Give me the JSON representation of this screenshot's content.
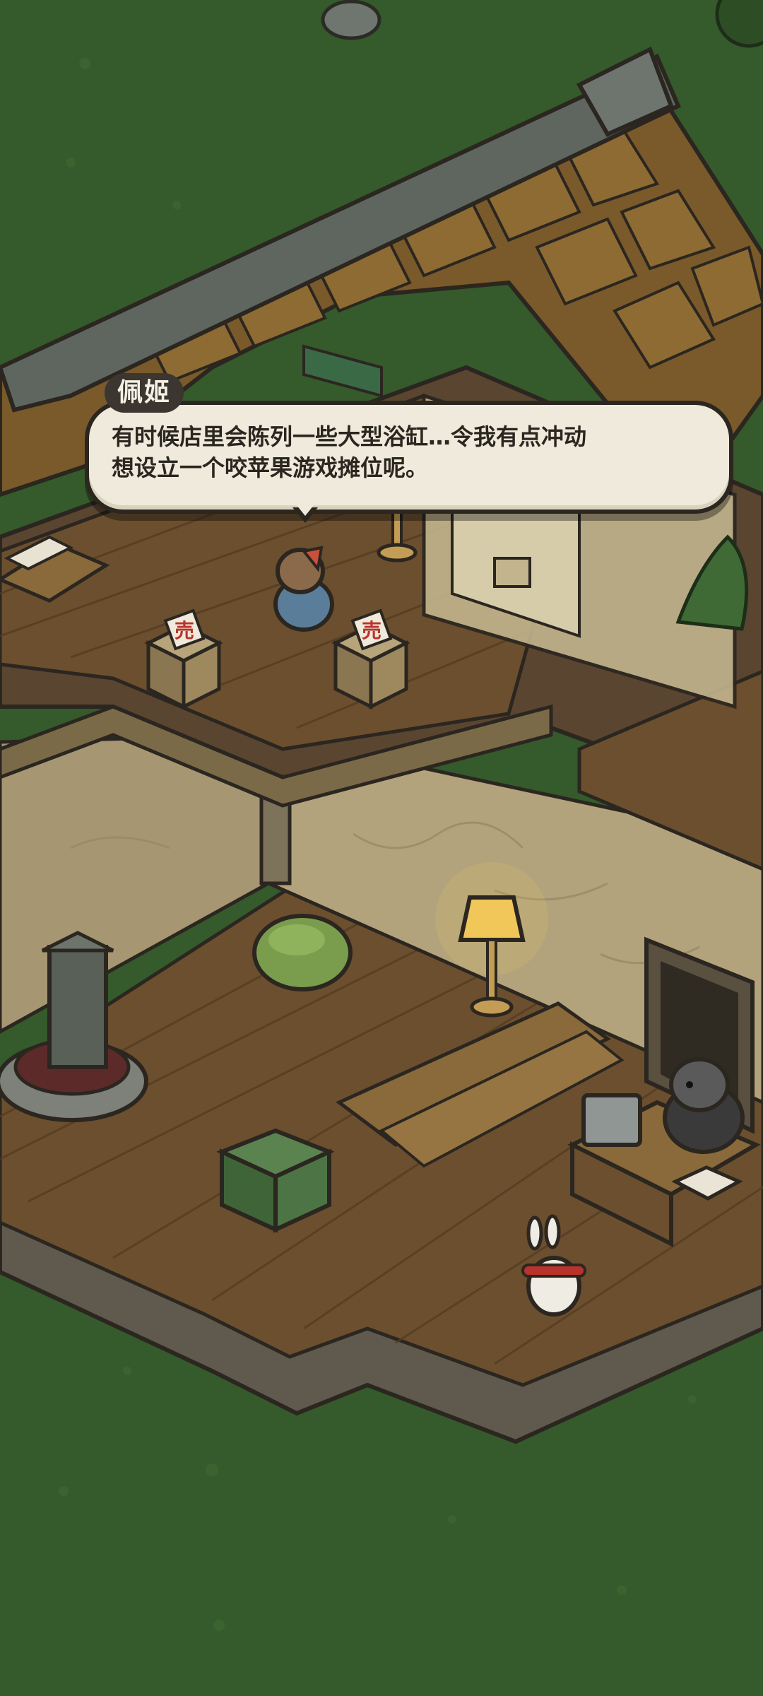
{
  "dialogue": {
    "speaker": "佩姬",
    "line1": "有时候店里会陈列一些大型浴缸…令我有点冲动",
    "line2": "想设立一个咬苹果游戏摊位呢。"
  },
  "scene": {
    "signs": {
      "left": "売",
      "right": "売"
    },
    "icons": [
      "lamp-icon",
      "fountain-icon",
      "cash-register-icon",
      "book-icon",
      "bunny-icon"
    ]
  },
  "colors": {
    "grass": "#355a2b",
    "floor": "#6b4f2e",
    "wall": "#b3a37c",
    "roof": "#7a5a2a",
    "dialogue_bg": "#efeadb",
    "dialogue_border": "#2b2620"
  }
}
